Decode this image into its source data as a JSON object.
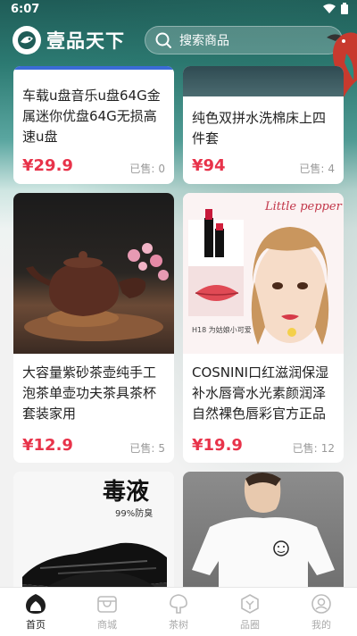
{
  "status": {
    "time": "6:07"
  },
  "header": {
    "app_name": "壹品天下",
    "search_placeholder": "搜索商品"
  },
  "products": [
    {
      "title": "车载u盘音乐u盘64G金属迷你优盘64G无损高速u盘",
      "price": "¥29.9",
      "sold_label": "已售:",
      "sold": "0"
    },
    {
      "title": "纯色双拼水洗棉床上四件套",
      "price": "¥94",
      "sold_label": "已售:",
      "sold": "4"
    },
    {
      "title": "大容量紫砂茶壶纯手工泡茶单壶功夫茶具茶杯套装家用",
      "price": "¥12.9",
      "sold_label": "已售:",
      "sold": "5"
    },
    {
      "title": "COSNINI口红滋润保湿补水唇膏水光素颜润泽自然裸色唇彩官方正品",
      "price": "¥19.9",
      "sold_label": "已售:",
      "sold": "12"
    }
  ],
  "images": {
    "lipstick_brand": "Little pepper",
    "lipstick_caption": "H18 为姑娘小可爱",
    "shoe_text": "毒液",
    "shoe_sub": "99%防臭"
  },
  "tabs": [
    {
      "label": "首页",
      "icon": "home-icon",
      "active": true
    },
    {
      "label": "商城",
      "icon": "shop-icon",
      "active": false
    },
    {
      "label": "茶树",
      "icon": "tree-icon",
      "active": false
    },
    {
      "label": "品圈",
      "icon": "circle-icon",
      "active": false
    },
    {
      "label": "我的",
      "icon": "profile-icon",
      "active": false
    }
  ],
  "colors": {
    "price": "#e8334a",
    "header_bg": "#1f5c57"
  }
}
